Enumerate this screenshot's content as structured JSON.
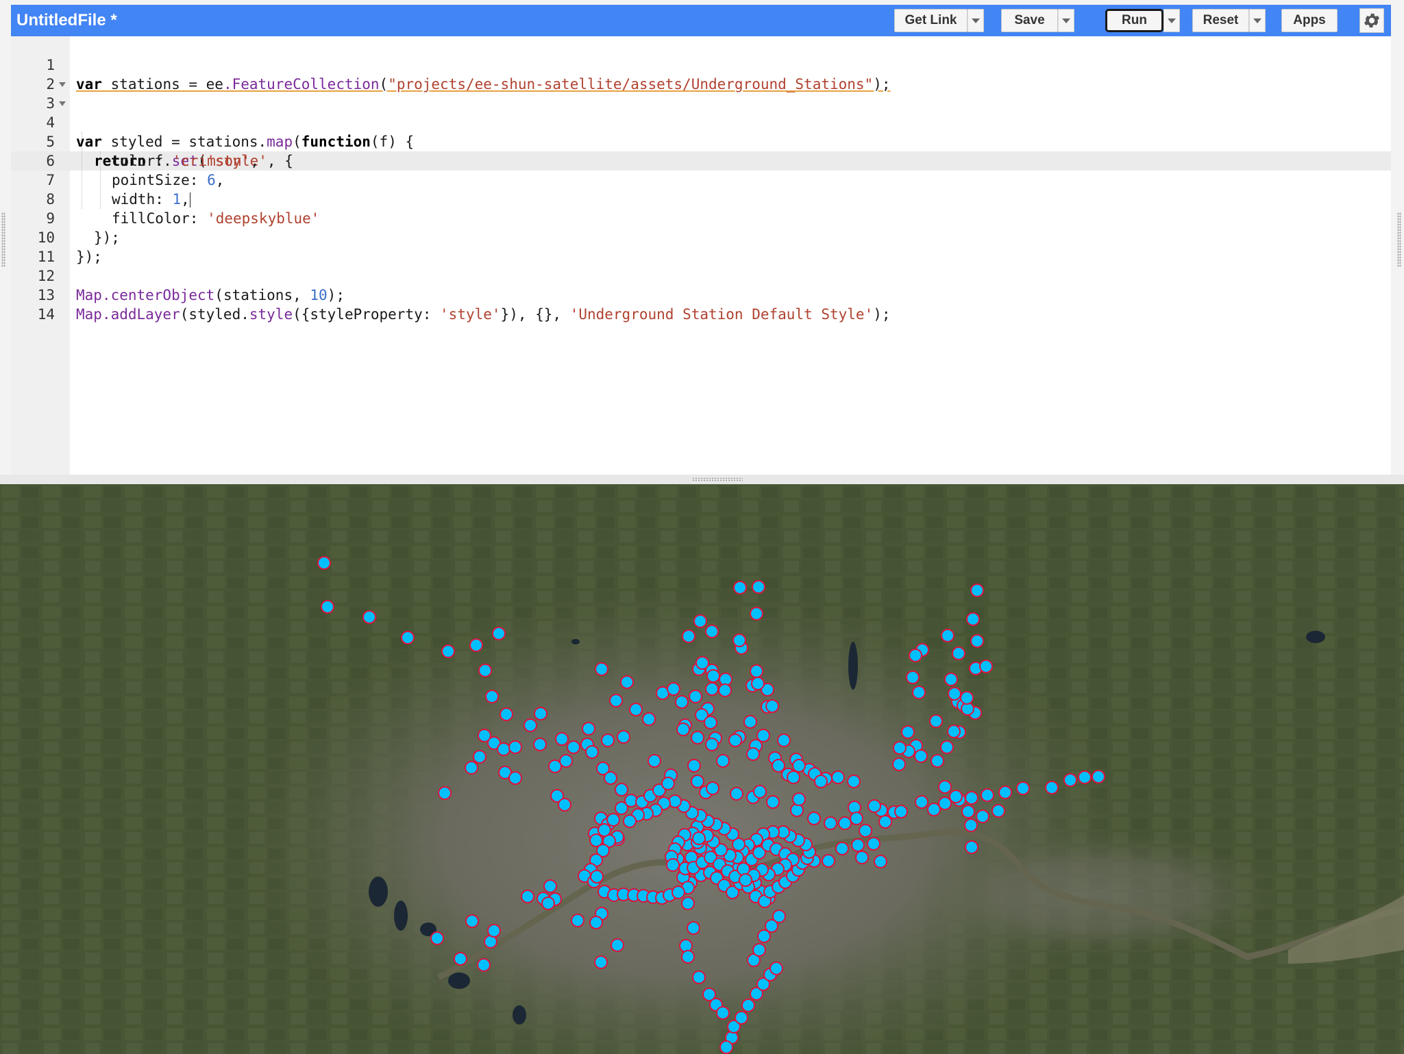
{
  "editor": {
    "title": "UntitledFile *",
    "toolbar": {
      "get_link": "Get Link",
      "save": "Save",
      "run": "Run",
      "reset": "Reset",
      "apps": "Apps",
      "settings_icon": "gear-icon"
    },
    "lines": [
      {
        "n": "1"
      },
      {
        "n": "2"
      },
      {
        "n": "3"
      },
      {
        "n": "4"
      },
      {
        "n": "5"
      },
      {
        "n": "6"
      },
      {
        "n": "7"
      },
      {
        "n": "8"
      },
      {
        "n": "9"
      },
      {
        "n": "10"
      },
      {
        "n": "11"
      },
      {
        "n": "12"
      },
      {
        "n": "13"
      },
      {
        "n": "14"
      }
    ],
    "code": {
      "l1": {
        "kw": "var",
        "text1": " stations = ",
        "ee": "ee",
        "fn": ".FeatureCollection",
        "p1": "(",
        "str": "\"projects/ee-shun-satellite/assets/Underground_Stations\"",
        "p2": ");"
      },
      "l3": {
        "kw": "var",
        "text1": " styled = stations.",
        "fn": "map",
        "p1": "(",
        "kw2": "function",
        "text2": "(f) {"
      },
      "l4": {
        "kw": "return",
        "text1": " f.",
        "fn": "set",
        "p1": "(",
        "str": "'style'",
        "text2": ", {"
      },
      "l5": {
        "key": "color: ",
        "str": "'crimson'",
        "text": ","
      },
      "l6": {
        "key": "pointSize: ",
        "num": "6",
        "text": ","
      },
      "l7": {
        "key": "width: ",
        "num": "1",
        "text": ","
      },
      "l8": {
        "key": "fillColor: ",
        "str": "'deepskyblue'"
      },
      "l9": {
        "text": "});"
      },
      "l10": {
        "text": "});"
      },
      "l12": {
        "fn": "Map.centerObject",
        "text1": "(stations, ",
        "num": "10",
        "text2": ");"
      },
      "l13": {
        "fn": "Map.addLayer",
        "text1": "(styled.",
        "fn2": "style",
        "text2": "({styleProperty: ",
        "str": "'style'",
        "text3": "}), {}, ",
        "str2": "'Underground Station Default Style'",
        "text4": ");"
      }
    }
  },
  "map": {
    "layer_name": "Underground Station Default Style",
    "point_style": {
      "fill": "#00bfff",
      "stroke": "#dc143c"
    },
    "colors": {
      "land": "#4d5a3a",
      "urban": "#6f6d64",
      "river": "#6b6b55",
      "water": "#1e2a3a"
    }
  }
}
